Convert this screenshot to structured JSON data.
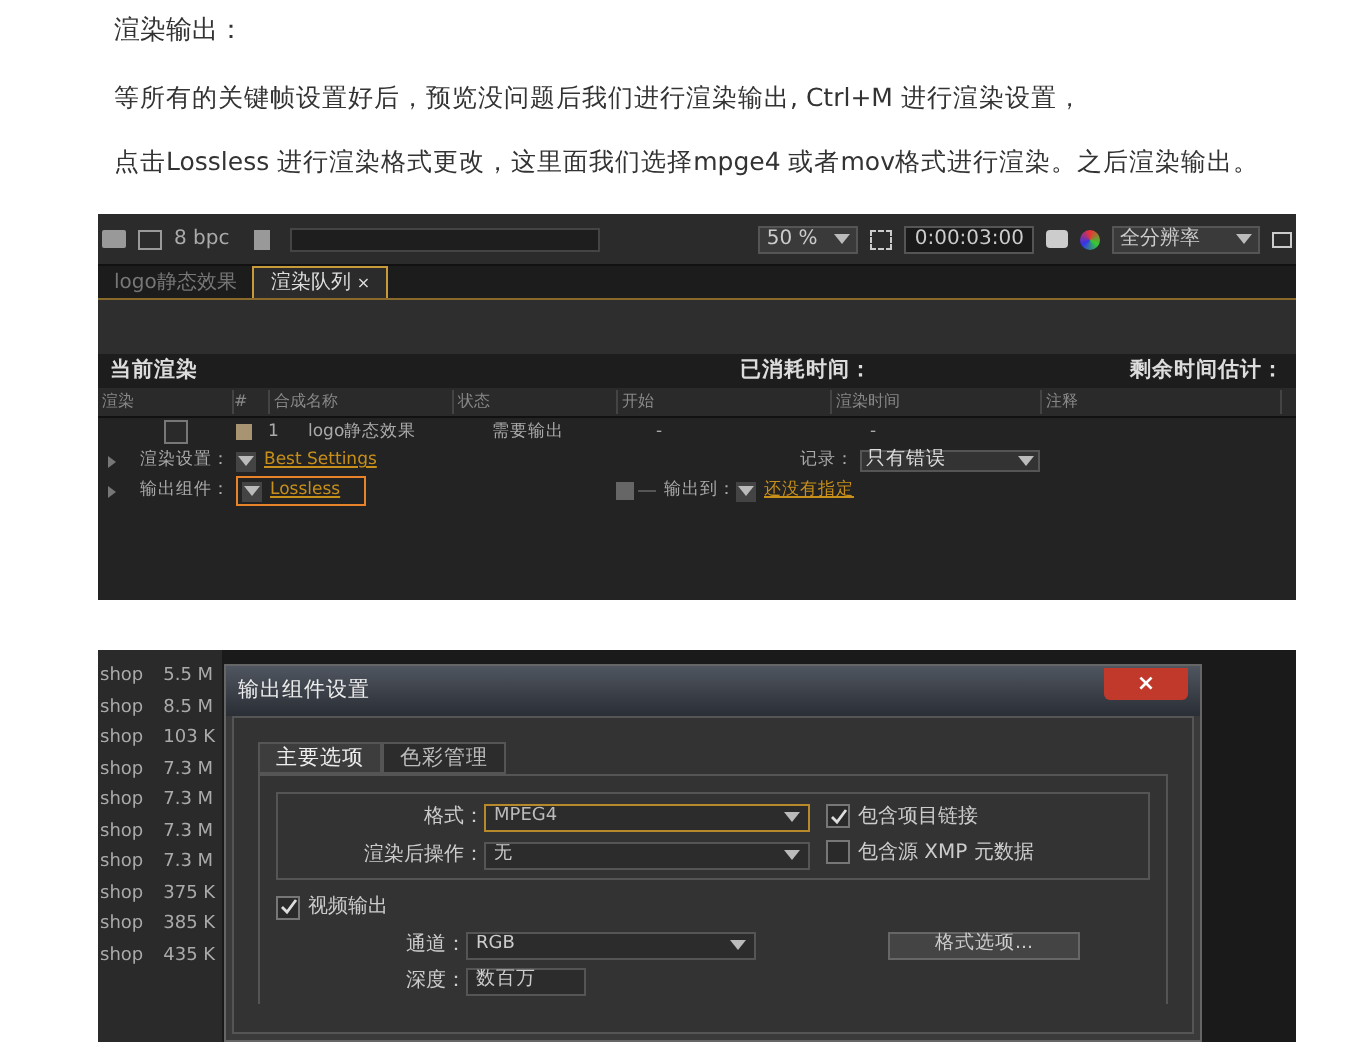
{
  "article": {
    "heading": "渲染输出：",
    "paragraphs": [
      "等所有的关键帧设置好后，预览没问题后我们进行渲染输出, Ctrl+M 进行渲染设置，",
      "点击Lossless 进行渲染格式更改，这里面我们选择mpge4 或者mov格式进行渲染。之后渲染输出。"
    ]
  },
  "render_panel": {
    "toolbar": {
      "bpc": "8 bpc",
      "zoom": "50 %",
      "timecode": "0:00:03:00",
      "resolution": "全分辨率"
    },
    "tabs": [
      {
        "label": "logo静态效果",
        "selected": false
      },
      {
        "label": "渲染队列",
        "selected": true,
        "close": "×"
      }
    ],
    "status": {
      "current": "当前渲染",
      "elapsed": "已消耗时间：",
      "remaining": "剩余时间估计："
    },
    "columns": [
      "渲染",
      "#",
      "合成名称",
      "状态",
      "开始",
      "渲染时间",
      "注释"
    ],
    "item": {
      "checked": false,
      "number": "1",
      "name": "logo静态效果",
      "status": "需要输出",
      "start": "-",
      "render_time": "-"
    },
    "render_settings": {
      "label": "渲染设置：",
      "value": "Best Settings",
      "log_label": "记录：",
      "log_value": "只有错误"
    },
    "output_module": {
      "label": "输出组件：",
      "value": "Lossless",
      "highlighted": true,
      "output_label": "输出到：",
      "output_value": "还没有指定"
    }
  },
  "dialog": {
    "side_list": [
      {
        "name": "shop",
        "size": "5.5 M"
      },
      {
        "name": "shop",
        "size": "8.5 M"
      },
      {
        "name": "shop",
        "size": "103 K"
      },
      {
        "name": "shop",
        "size": "7.3 M"
      },
      {
        "name": "shop",
        "size": "7.3 M"
      },
      {
        "name": "shop",
        "size": "7.3 M"
      },
      {
        "name": "shop",
        "size": "7.3 M"
      },
      {
        "name": "shop",
        "size": "375 K"
      },
      {
        "name": "shop",
        "size": "385 K"
      },
      {
        "name": "shop",
        "size": "435 K"
      }
    ],
    "title": "输出组件设置",
    "close": "×",
    "tabs": [
      {
        "label": "主要选项",
        "selected": true
      },
      {
        "label": "色彩管理",
        "selected": false
      }
    ],
    "format_label": "格式：",
    "format_value": "MPEG4",
    "post_label": "渲染后操作：",
    "post_value": "无",
    "options": [
      {
        "label": "包含项目链接",
        "checked": true
      },
      {
        "label": "包含源 XMP 元数据",
        "checked": false
      }
    ],
    "video": {
      "label": "视频输出",
      "checked": true,
      "channel_label": "通道：",
      "channel_value": "RGB",
      "format_options": "格式选项...",
      "depth_label": "深度：",
      "depth_value": "数百万"
    }
  }
}
